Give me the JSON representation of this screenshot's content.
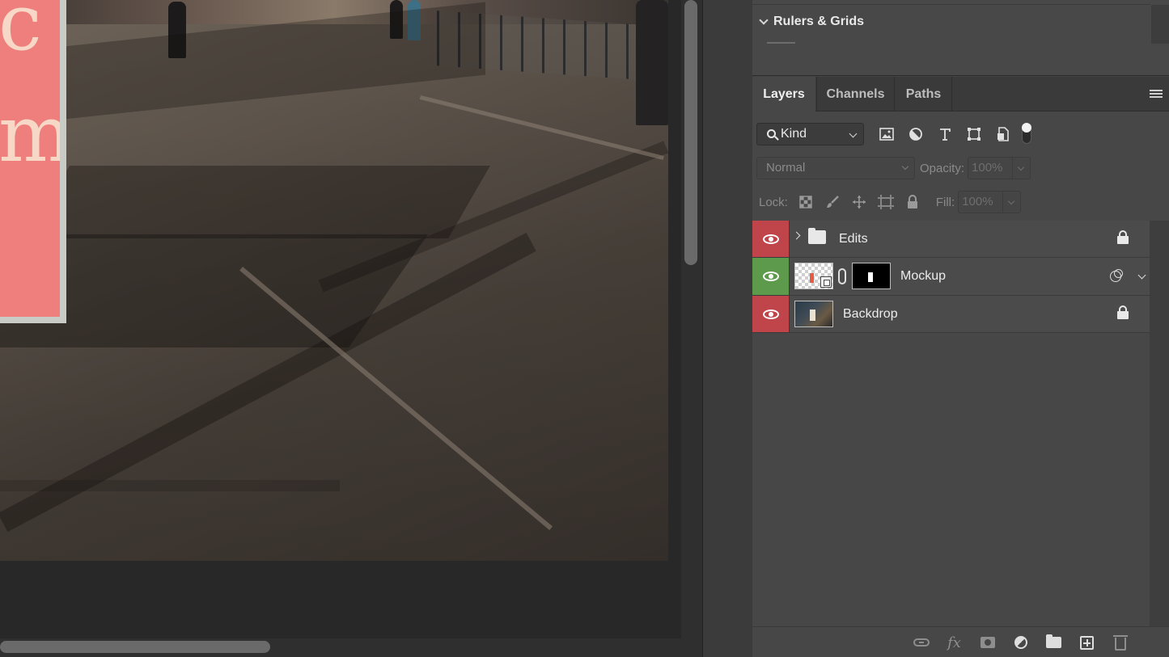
{
  "rulers_panel": {
    "title": "Rulers & Grids"
  },
  "layers_panel": {
    "tabs": [
      "Layers",
      "Channels",
      "Paths"
    ],
    "active_tab": "Layers",
    "filter": {
      "value": "Kind",
      "icons": [
        "image-filter-icon",
        "adjustment-filter-icon",
        "type-filter-icon",
        "shape-filter-icon",
        "smart-object-filter-icon"
      ]
    },
    "blend_mode": "Normal",
    "opacity_label": "Opacity:",
    "opacity_value": "100%",
    "lock_label": "Lock:",
    "fill_label": "Fill:",
    "fill_value": "100%",
    "lock_icons": [
      "lock-transparent-pixels-icon",
      "lock-image-pixels-icon",
      "lock-position-icon",
      "lock-artboard-icon",
      "lock-all-icon"
    ],
    "layers": [
      {
        "name": "Edits",
        "type": "group",
        "visible": true,
        "eye_color": "#c0454b",
        "locked": true
      },
      {
        "name": "Mockup",
        "type": "smart-object",
        "visible": true,
        "eye_color": "#5e9a4b",
        "has_mask": true,
        "smart_filters": true
      },
      {
        "name": "Backdrop",
        "type": "image",
        "visible": true,
        "eye_color": "#c0454b",
        "locked": true
      }
    ],
    "footer_icons": [
      "link-layers-icon",
      "fx-icon",
      "add-mask-icon",
      "adjustment-layer-icon",
      "new-group-icon",
      "new-layer-icon",
      "delete-layer-icon"
    ]
  },
  "colors": {
    "eye_red": "#c0454b",
    "eye_green": "#5e9a4b",
    "panel_bg": "#474747",
    "poster_pink": "#ee7f7c"
  }
}
